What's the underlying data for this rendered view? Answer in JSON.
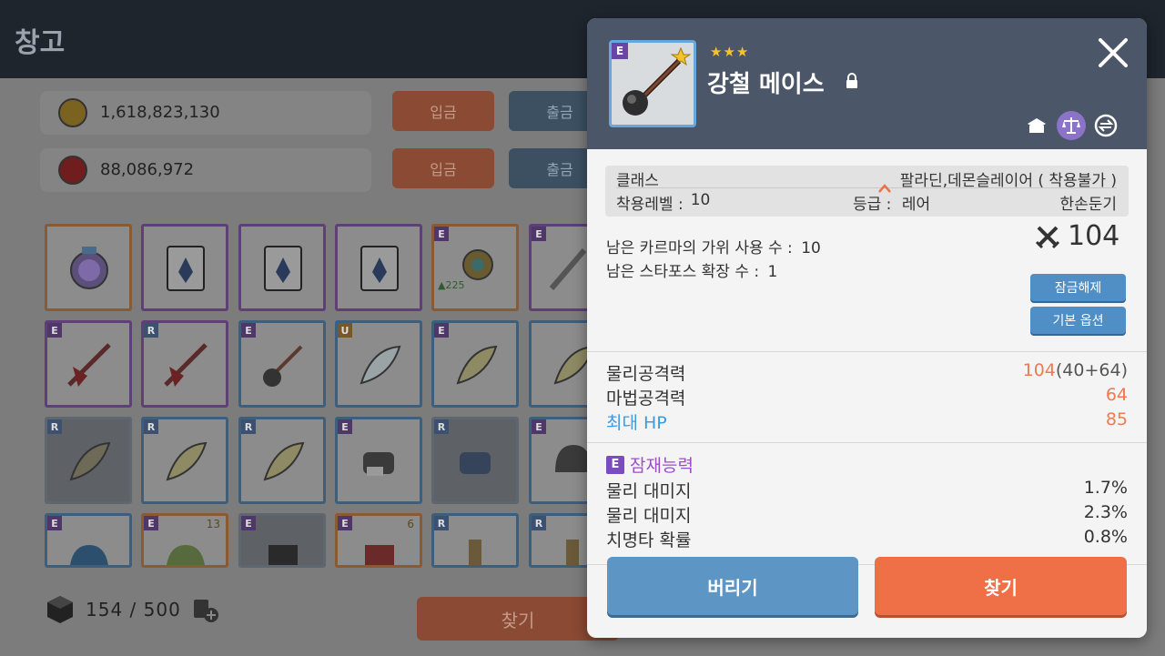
{
  "header": {
    "title": "창고"
  },
  "currencies": [
    {
      "coin_color": "#d7a92a",
      "amount": "1,618,823,130",
      "deposit_label": "입금",
      "withdraw_label": "출금"
    },
    {
      "coin_color": "#c4302f",
      "amount": "88,086,972",
      "deposit_label": "입금",
      "withdraw_label": "출금"
    }
  ],
  "inventory": {
    "rows": [
      [
        {
          "rank": "",
          "icon": "medal-icon"
        },
        {
          "rank": "",
          "icon": "crystal-icon"
        },
        {
          "rank": "",
          "icon": "crystal-icon"
        },
        {
          "rank": "",
          "icon": "crystal-icon"
        },
        {
          "rank": "E",
          "icon": "emblem-icon",
          "stat": "▲225"
        },
        {
          "rank": "E",
          "icon": "sword-icon"
        }
      ],
      [
        {
          "rank": "E",
          "icon": "spear-icon"
        },
        {
          "rank": "R",
          "icon": "spear-icon"
        },
        {
          "rank": "E",
          "icon": "mace-icon"
        },
        {
          "rank": "U",
          "icon": "feather-icon"
        },
        {
          "rank": "E",
          "icon": "feather-icon"
        },
        {
          "rank": "",
          "icon": "feather-icon"
        }
      ],
      [
        {
          "rank": "R",
          "icon": "feather-icon"
        },
        {
          "rank": "R",
          "icon": "feather-icon"
        },
        {
          "rank": "R",
          "icon": "feather-icon"
        },
        {
          "rank": "E",
          "icon": "gauntlet-icon"
        },
        {
          "rank": "R",
          "icon": "gauntlet-icon"
        },
        {
          "rank": "E",
          "icon": "helmet-icon"
        }
      ],
      [
        {
          "rank": "E",
          "icon": "hat-icon"
        },
        {
          "rank": "E",
          "icon": "hat-icon",
          "count": "13"
        },
        {
          "rank": "E",
          "icon": "armor-icon"
        },
        {
          "rank": "E",
          "icon": "armor-icon",
          "count": "6"
        },
        {
          "rank": "R",
          "icon": "boots-icon"
        },
        {
          "rank": "R",
          "icon": "boots-icon"
        }
      ]
    ],
    "capacity": "154 / 500",
    "find_label": "찾기"
  },
  "item": {
    "rank": "E",
    "stars": "★★★",
    "name": "강철 메이스",
    "info": {
      "class_label": "클래스",
      "class_value": "팔라딘,데몬슬레이어 ( 착용불가 )",
      "level_label": "착용레벨 :",
      "level_value": "10",
      "grade_label": "등급 :",
      "grade_value": "레어",
      "type_value": "한손둔기"
    },
    "karma_scissors": "남은 카르마의 가위 사용 수 :",
    "karma_scissors_value": "10",
    "starforce": "남은 스타포스 확장 수 :",
    "starforce_value": "1",
    "attack_power": "104",
    "unlock_label": "잠금해제",
    "base_option_label": "기본 옵션",
    "stats": [
      {
        "label": "물리공격력",
        "value": "104",
        "detail": "(40+64)"
      },
      {
        "label": "마법공격력",
        "value": "64",
        "detail": ""
      },
      {
        "label": "최대 HP",
        "value": "85",
        "detail": ""
      }
    ],
    "potential_label": "잠재능력",
    "potential_rank": "E",
    "potentials": [
      {
        "label": "물리 대미지",
        "value": "1.7%"
      },
      {
        "label": "물리 대미지",
        "value": "2.3%"
      },
      {
        "label": "치명타 확률",
        "value": "0.8%"
      }
    ],
    "discard_label": "버리기",
    "find_label": "찾기"
  },
  "colors": {
    "accent_orange": "#ef7047",
    "accent_blue": "#5d95c4",
    "header": "#4b5668"
  }
}
